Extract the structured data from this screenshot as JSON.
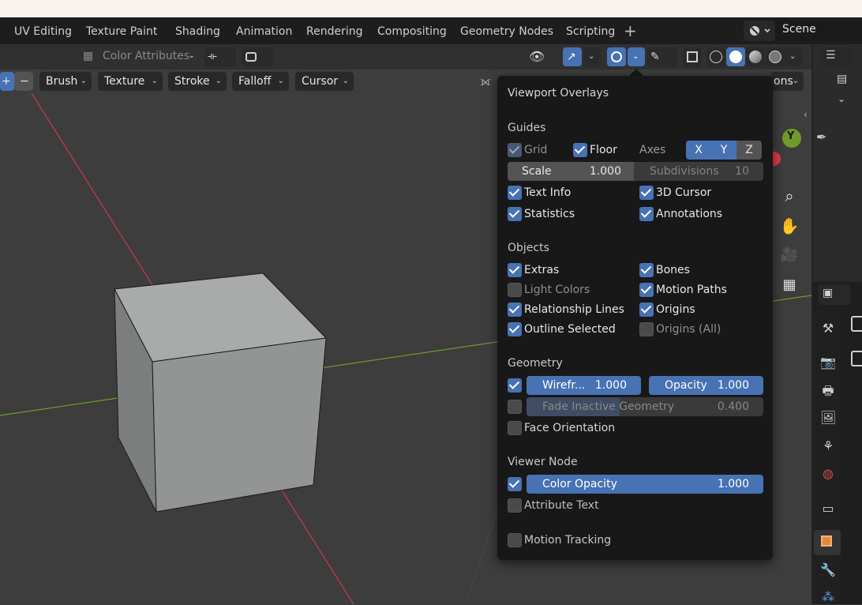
{
  "workspace_tabs": [
    "UV Editing",
    "Texture Paint",
    "Shading",
    "Animation",
    "Rendering",
    "Compositing",
    "Geometry Nodes",
    "Scripting"
  ],
  "add_workspace": "+",
  "scene_name": "Scene",
  "header": {
    "color_attributes": "Color Attributes"
  },
  "tool_header": {
    "add": "+",
    "subtract": "−",
    "brush": "Brush",
    "texture": "Texture",
    "stroke": "Stroke",
    "falloff": "Falloff",
    "cursor": "Cursor",
    "options_partial": "ons"
  },
  "gizmo": {
    "y": "Y"
  },
  "overlays": {
    "title": "Viewport Overlays",
    "guides": {
      "heading": "Guides",
      "grid": "Grid",
      "floor": "Floor",
      "axes": "Axes",
      "axis_x": "X",
      "axis_y": "Y",
      "axis_z": "Z",
      "scale_label": "Scale",
      "scale_value": "1.000",
      "subdivisions_label": "Subdivisions",
      "subdivisions_value": "10",
      "text_info": "Text Info",
      "cursor_3d": "3D Cursor",
      "statistics": "Statistics",
      "annotations": "Annotations"
    },
    "objects": {
      "heading": "Objects",
      "extras": "Extras",
      "bones": "Bones",
      "light_colors": "Light Colors",
      "motion_paths": "Motion Paths",
      "relationship_lines": "Relationship Lines",
      "origins": "Origins",
      "outline_selected": "Outline Selected",
      "origins_all": "Origins (All)"
    },
    "geometry": {
      "heading": "Geometry",
      "wireframe_label": "Wirefr...",
      "wireframe_value": "1.000",
      "opacity_label": "Opacity",
      "opacity_value": "1.000",
      "fade_label": "Fade Inactive Geometry",
      "fade_value": "0.400",
      "face_orientation": "Face Orientation"
    },
    "viewer_node": {
      "heading": "Viewer Node",
      "color_opacity_label": "Color Opacity",
      "color_opacity_value": "1.000",
      "attribute_text": "Attribute Text"
    },
    "motion_tracking": "Motion Tracking"
  },
  "colors": {
    "accent": "#4772b3",
    "axis_x": "#c9384a",
    "axis_y": "#6e9a2d"
  }
}
